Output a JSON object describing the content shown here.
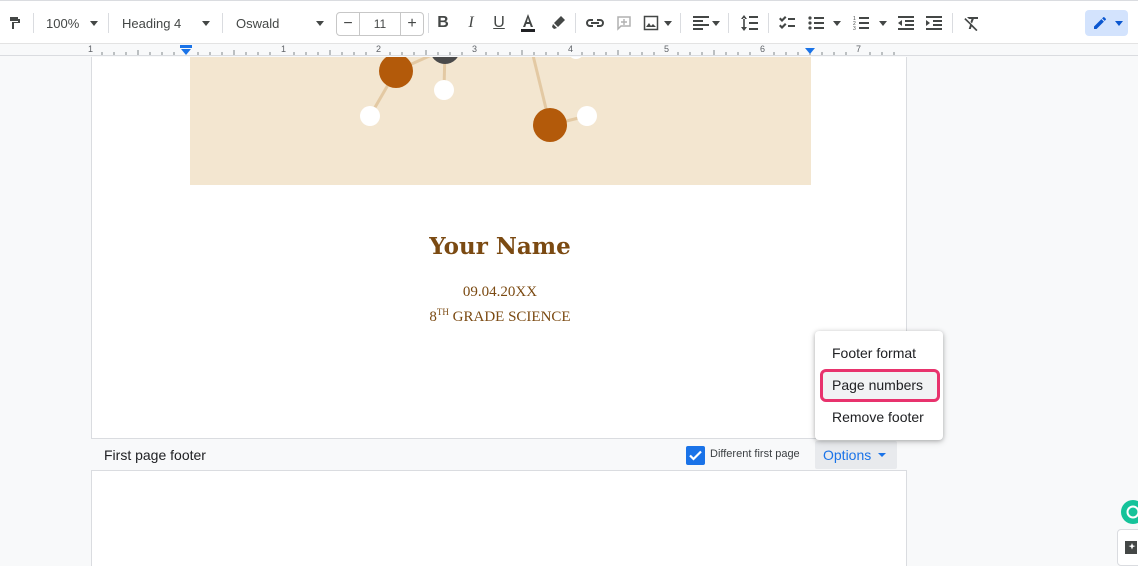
{
  "toolbar": {
    "zoom": "100%",
    "style": "Heading 4",
    "font": "Oswald",
    "font_size": "11",
    "font_size_minus": "−",
    "font_size_plus": "+"
  },
  "ruler": {
    "marks": [
      "1",
      "1",
      "2",
      "3",
      "4",
      "5",
      "6",
      "7"
    ]
  },
  "document": {
    "name": "Your Name",
    "date": "09.04.20XX",
    "grade_num": "8",
    "grade_sup": "TH",
    "grade_text": " GRADE SCIENCE"
  },
  "footer": {
    "label": "First page footer",
    "different_first_page": "Different first page",
    "options": "Options"
  },
  "menu": {
    "items": [
      "Footer format",
      "Page numbers",
      "Remove footer"
    ]
  },
  "colors": {
    "accent": "#1a73e8",
    "highlight": "#e8336d",
    "heading": "#7b4a12"
  }
}
